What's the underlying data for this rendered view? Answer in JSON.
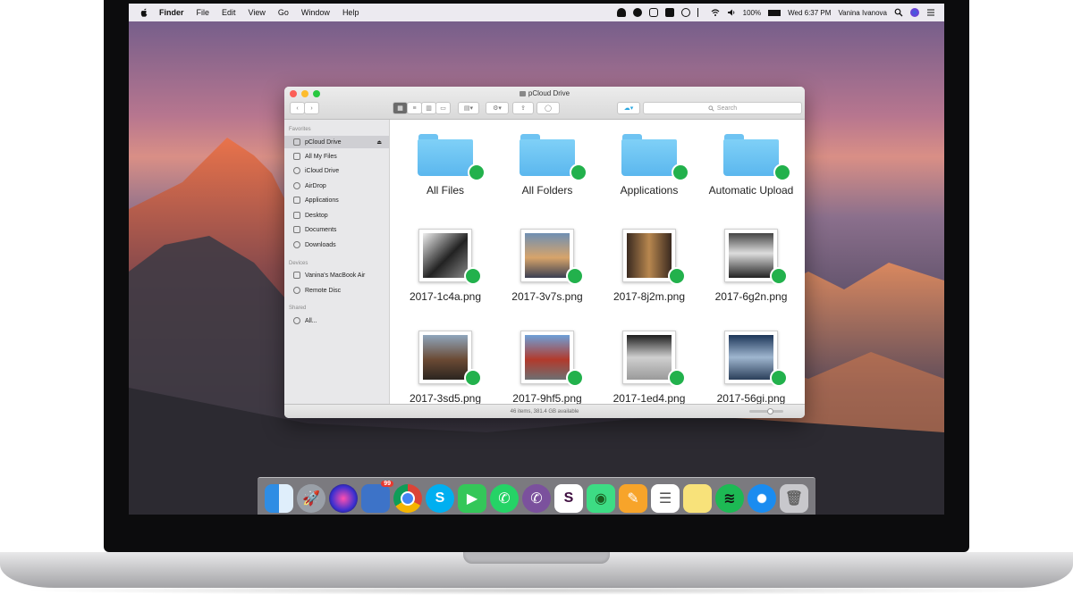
{
  "menubar": {
    "app": "Finder",
    "menus": [
      "File",
      "Edit",
      "View",
      "Go",
      "Window",
      "Help"
    ],
    "battery": "100%",
    "clock": "Wed 6:37 PM",
    "user": "Vanina Ivanova"
  },
  "window": {
    "title": "pCloud Drive",
    "search_placeholder": "Search",
    "status": "46 items, 381.4 GB available"
  },
  "sidebar": {
    "favorites_header": "Favorites",
    "favorites": [
      "pCloud Drive",
      "All My Files",
      "iCloud Drive",
      "AirDrop",
      "Applications",
      "Desktop",
      "Documents",
      "Downloads"
    ],
    "devices_header": "Devices",
    "devices": [
      "Vanina's MacBook Air",
      "Remote Disc"
    ],
    "shared_header": "Shared",
    "shared": [
      "All..."
    ]
  },
  "content": {
    "folders": [
      "All Files",
      "All Folders",
      "Applications",
      "Automatic Upload"
    ],
    "files_row1": [
      "2017-1c4a.png",
      "2017-3v7s.png",
      "2017-8j2m.png",
      "2017-6g2n.png"
    ],
    "files_row2": [
      "2017-3sd5.png",
      "2017-9hf5.png",
      "2017-1ed4.png",
      "2017-56gi.png"
    ]
  },
  "dock": {
    "badge": "99",
    "icons": [
      "finder-icon",
      "launchpad-icon",
      "siri-icon",
      "preview-icon",
      "chrome-icon",
      "skype-icon",
      "facetime-icon",
      "whatsapp-icon",
      "viber-icon",
      "slack-icon",
      "android-icon",
      "pages-icon",
      "reminders-icon",
      "notes-icon",
      "spotify-icon",
      "safari-icon",
      "trash-icon"
    ]
  },
  "colors": {
    "accent": "#22b14c",
    "folder": "#5bb7ee",
    "sidebar_selected": "#cfcfd3"
  }
}
